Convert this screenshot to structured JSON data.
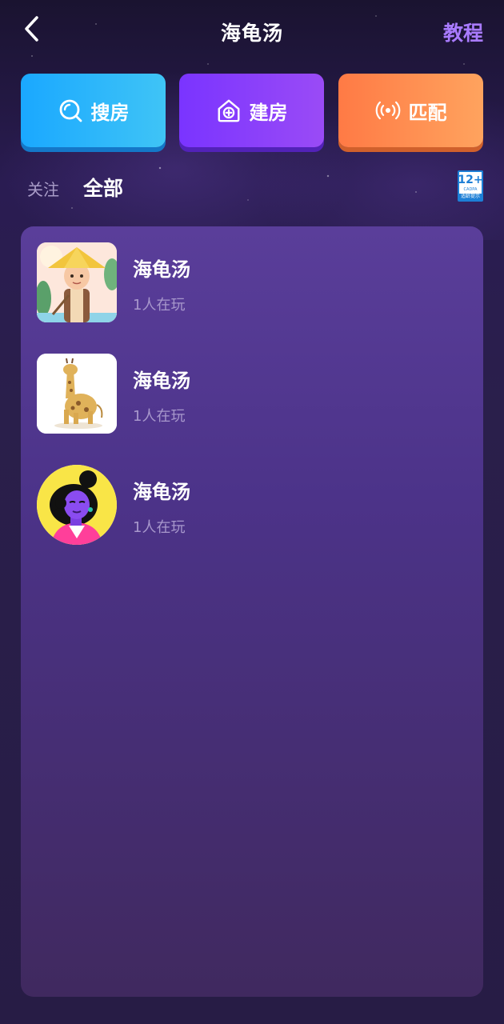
{
  "header": {
    "title": "海龟汤",
    "tutorial_label": "教程",
    "back_icon": "chevron-left-icon"
  },
  "actions": [
    {
      "label": "搜房",
      "icon": "search-icon",
      "color": "#1aa8ff"
    },
    {
      "label": "建房",
      "icon": "house-plus-icon",
      "color": "#7a34ff"
    },
    {
      "label": "匹配",
      "icon": "broadcast-icon",
      "color": "#ff7a45"
    }
  ],
  "tabs": {
    "follow": "关注",
    "all": "全部",
    "active": "全部"
  },
  "age_badge": {
    "age": "12+",
    "line1": "CADPA",
    "line2": "适龄提示"
  },
  "rooms": [
    {
      "name": "海龟汤",
      "players": "1人在玩",
      "avatar": "farmer-straw-hat-avatar"
    },
    {
      "name": "海龟汤",
      "players": "1人在玩",
      "avatar": "giraffe-avatar"
    },
    {
      "name": "海龟汤",
      "players": "1人在玩",
      "avatar": "purple-woman-avatar"
    }
  ],
  "colors": {
    "accent": "#a97bff",
    "panel": "#4c3389",
    "muted_text": "#a898cc"
  }
}
